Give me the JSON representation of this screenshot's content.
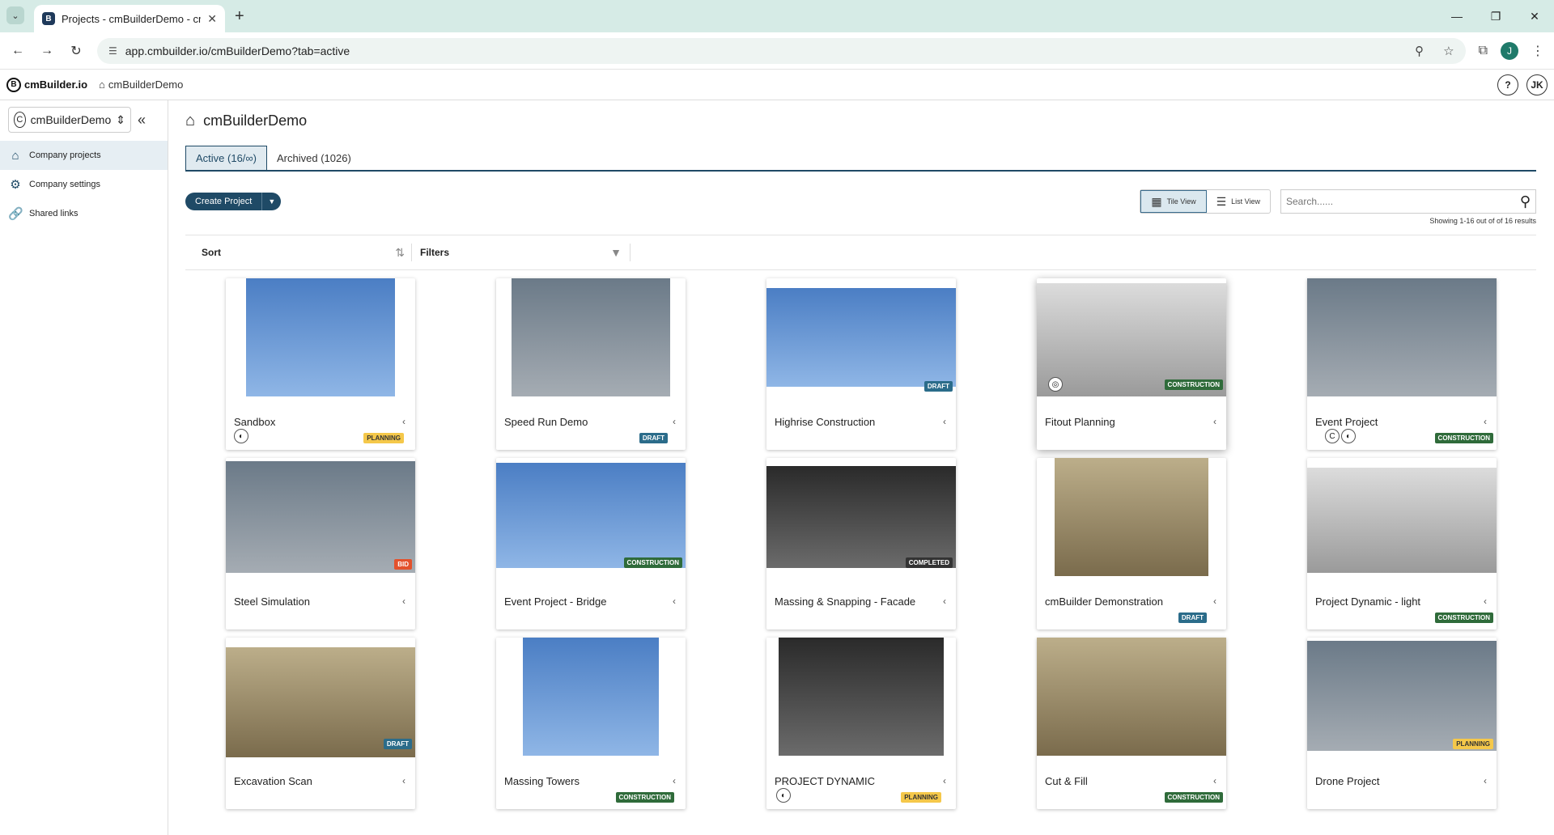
{
  "browser": {
    "tab_title": "Projects - cmBuilderDemo - cm",
    "url": "app.cmbuilder.io/cmBuilderDemo?tab=active",
    "profile_initial": "J"
  },
  "header": {
    "logo_text": "cmBuilder.io",
    "breadcrumb": "cmBuilderDemo",
    "help_label": "?",
    "user_initials": "JK"
  },
  "sidebar": {
    "company_initial": "C",
    "company_name": "cmBuilderDemo",
    "items": [
      {
        "label": "Company projects"
      },
      {
        "label": "Company settings"
      },
      {
        "label": "Shared links"
      }
    ]
  },
  "main": {
    "title": "cmBuilderDemo",
    "tabs": [
      {
        "label": "Active (16/∞)"
      },
      {
        "label": "Archived (1026)"
      }
    ],
    "create_label": "Create Project",
    "tile_view_label": "Tile View",
    "list_view_label": "List View",
    "search_placeholder": "Search......",
    "results_text": "Showing 1-16 out of of 16 results",
    "sort_label": "Sort",
    "filters_label": "Filters"
  },
  "projects": [
    {
      "name": "Sandbox",
      "status": "PLANNING"
    },
    {
      "name": "Speed Run Demo",
      "status": "DRAFT"
    },
    {
      "name": "Highrise Construction",
      "status": "DRAFT"
    },
    {
      "name": "Fitout Planning",
      "status": "CONSTRUCTION"
    },
    {
      "name": "Event Project",
      "status": "CONSTRUCTION"
    },
    {
      "name": "Steel Simulation",
      "status": "BID"
    },
    {
      "name": "Event Project - Bridge",
      "status": "CONSTRUCTION"
    },
    {
      "name": "Massing & Snapping - Facade",
      "status": "COMPLETED"
    },
    {
      "name": "cmBuilder Demonstration",
      "status": "DRAFT"
    },
    {
      "name": "Project Dynamic - light",
      "status": "CONSTRUCTION"
    },
    {
      "name": "Excavation Scan",
      "status": "DRAFT"
    },
    {
      "name": "Massing Towers",
      "status": "CONSTRUCTION"
    },
    {
      "name": "PROJECT DYNAMIC",
      "status": "PLANNING"
    },
    {
      "name": "Cut & Fill",
      "status": "CONSTRUCTION"
    },
    {
      "name": "Drone Project",
      "status": "PLANNING"
    }
  ],
  "colors": {
    "accent": "#1f4a66",
    "planning": "#f5c84a",
    "draft": "#2b6c8a",
    "construction": "#2f6b3a",
    "bid": "#e3512c",
    "completed": "#333333"
  }
}
